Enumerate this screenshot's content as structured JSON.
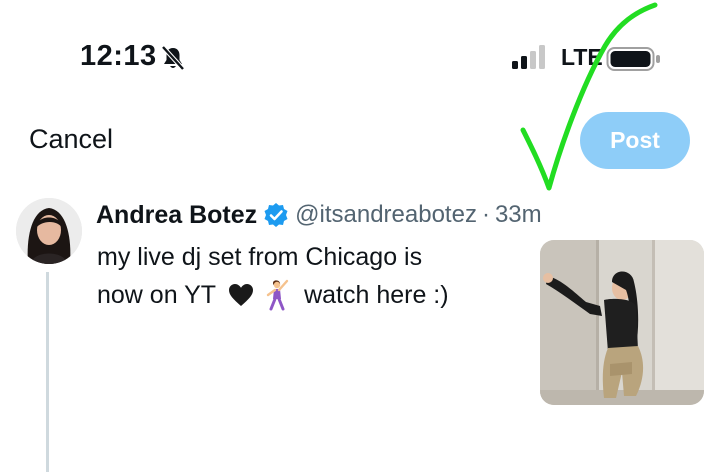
{
  "status_bar": {
    "time": "12:13",
    "network": "LTE"
  },
  "compose": {
    "cancel_label": "Cancel",
    "post_label": "Post",
    "post_color": "#8ecdf8",
    "annotation_color": "#22dd22"
  },
  "tweet": {
    "display_name": "Andrea Botez",
    "handle": "@itsandreabotez",
    "separator": "·",
    "time_ago": "33m",
    "text_line1": "my live dj set from Chicago is",
    "text_line2_start": "now on YT",
    "text_line2_end": "watch here :)",
    "emojis": [
      "black-heart-icon",
      "dancer-icon"
    ],
    "verified_color": "#1d9bf0"
  }
}
